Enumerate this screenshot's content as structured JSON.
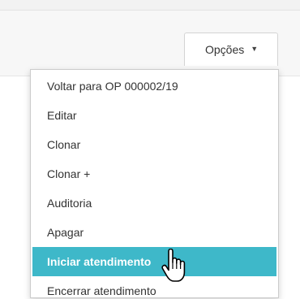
{
  "header": {
    "options_label": "Opções",
    "options_caret_icon": "caret-down-icon"
  },
  "menu": {
    "items": [
      {
        "label": "Voltar para OP 000002/19"
      },
      {
        "label": "Editar"
      },
      {
        "label": "Clonar"
      },
      {
        "label": "Clonar +"
      },
      {
        "label": "Auditoria"
      },
      {
        "label": "Apagar"
      },
      {
        "label": "Iniciar atendimento",
        "active": true
      },
      {
        "label": "Encerrar atendimento"
      }
    ]
  },
  "colors": {
    "accent": "#3eb8c9",
    "text": "#333333"
  },
  "cursor_icon": "hand-pointer-icon"
}
